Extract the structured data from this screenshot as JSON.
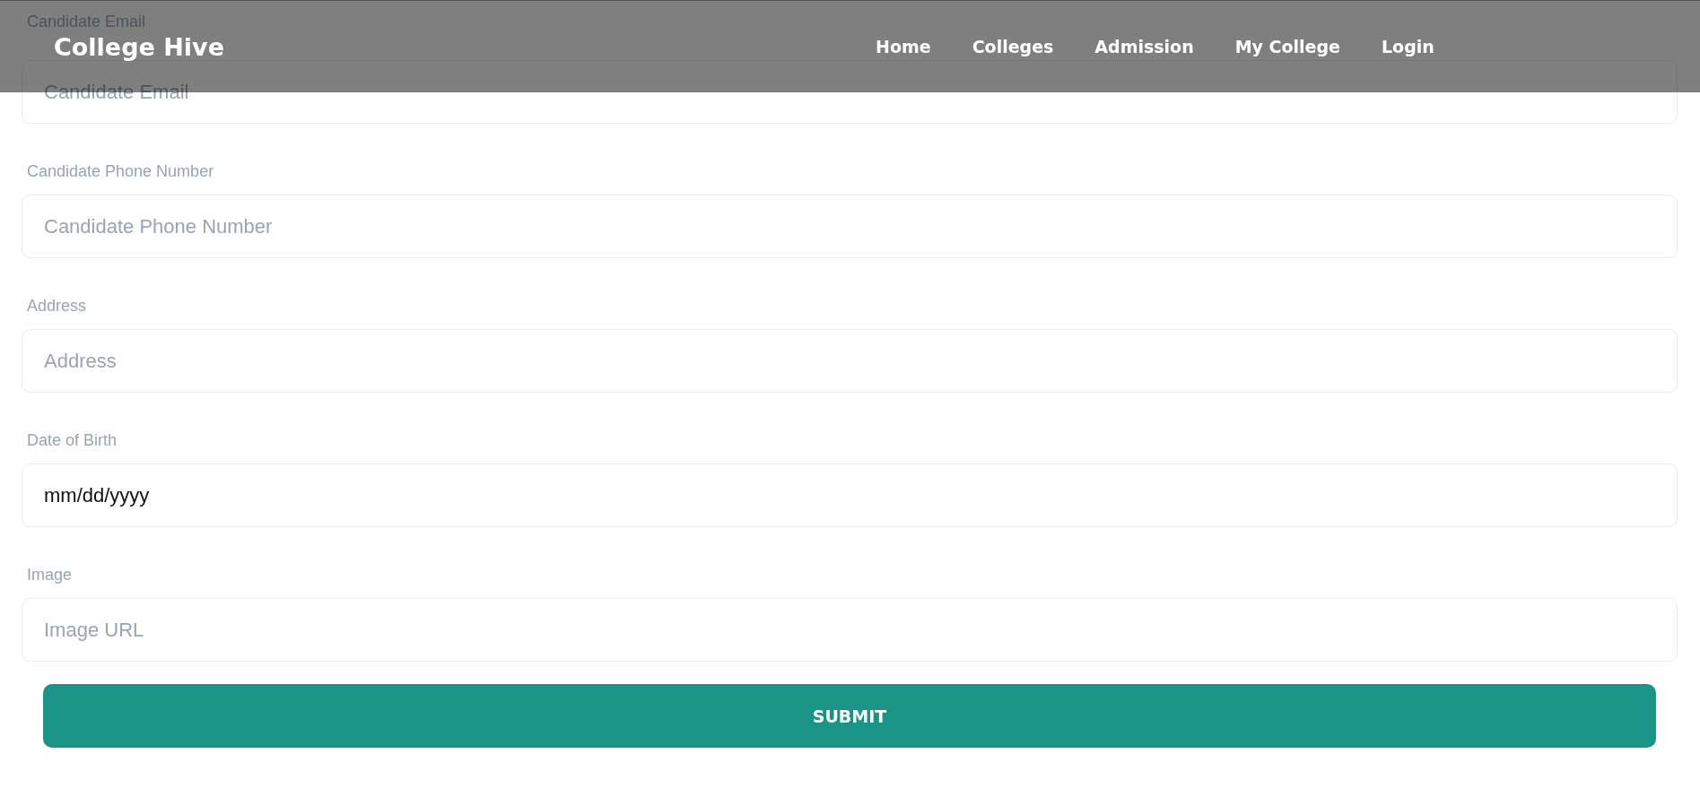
{
  "navbar": {
    "logo": "College Hive",
    "links": [
      {
        "label": "Home"
      },
      {
        "label": "Colleges"
      },
      {
        "label": "Admission"
      },
      {
        "label": "My College"
      },
      {
        "label": "Login"
      }
    ]
  },
  "form": {
    "fields": [
      {
        "label": "Candidate Email",
        "placeholder": "Candidate Email"
      },
      {
        "label": "Candidate Phone Number",
        "placeholder": "Candidate Phone Number"
      },
      {
        "label": "Address",
        "placeholder": "Address"
      },
      {
        "label": "Date of Birth",
        "value": "mm/dd/yyyy"
      },
      {
        "label": "Image",
        "placeholder": "Image URL"
      }
    ],
    "submit": "SUBMIT"
  }
}
